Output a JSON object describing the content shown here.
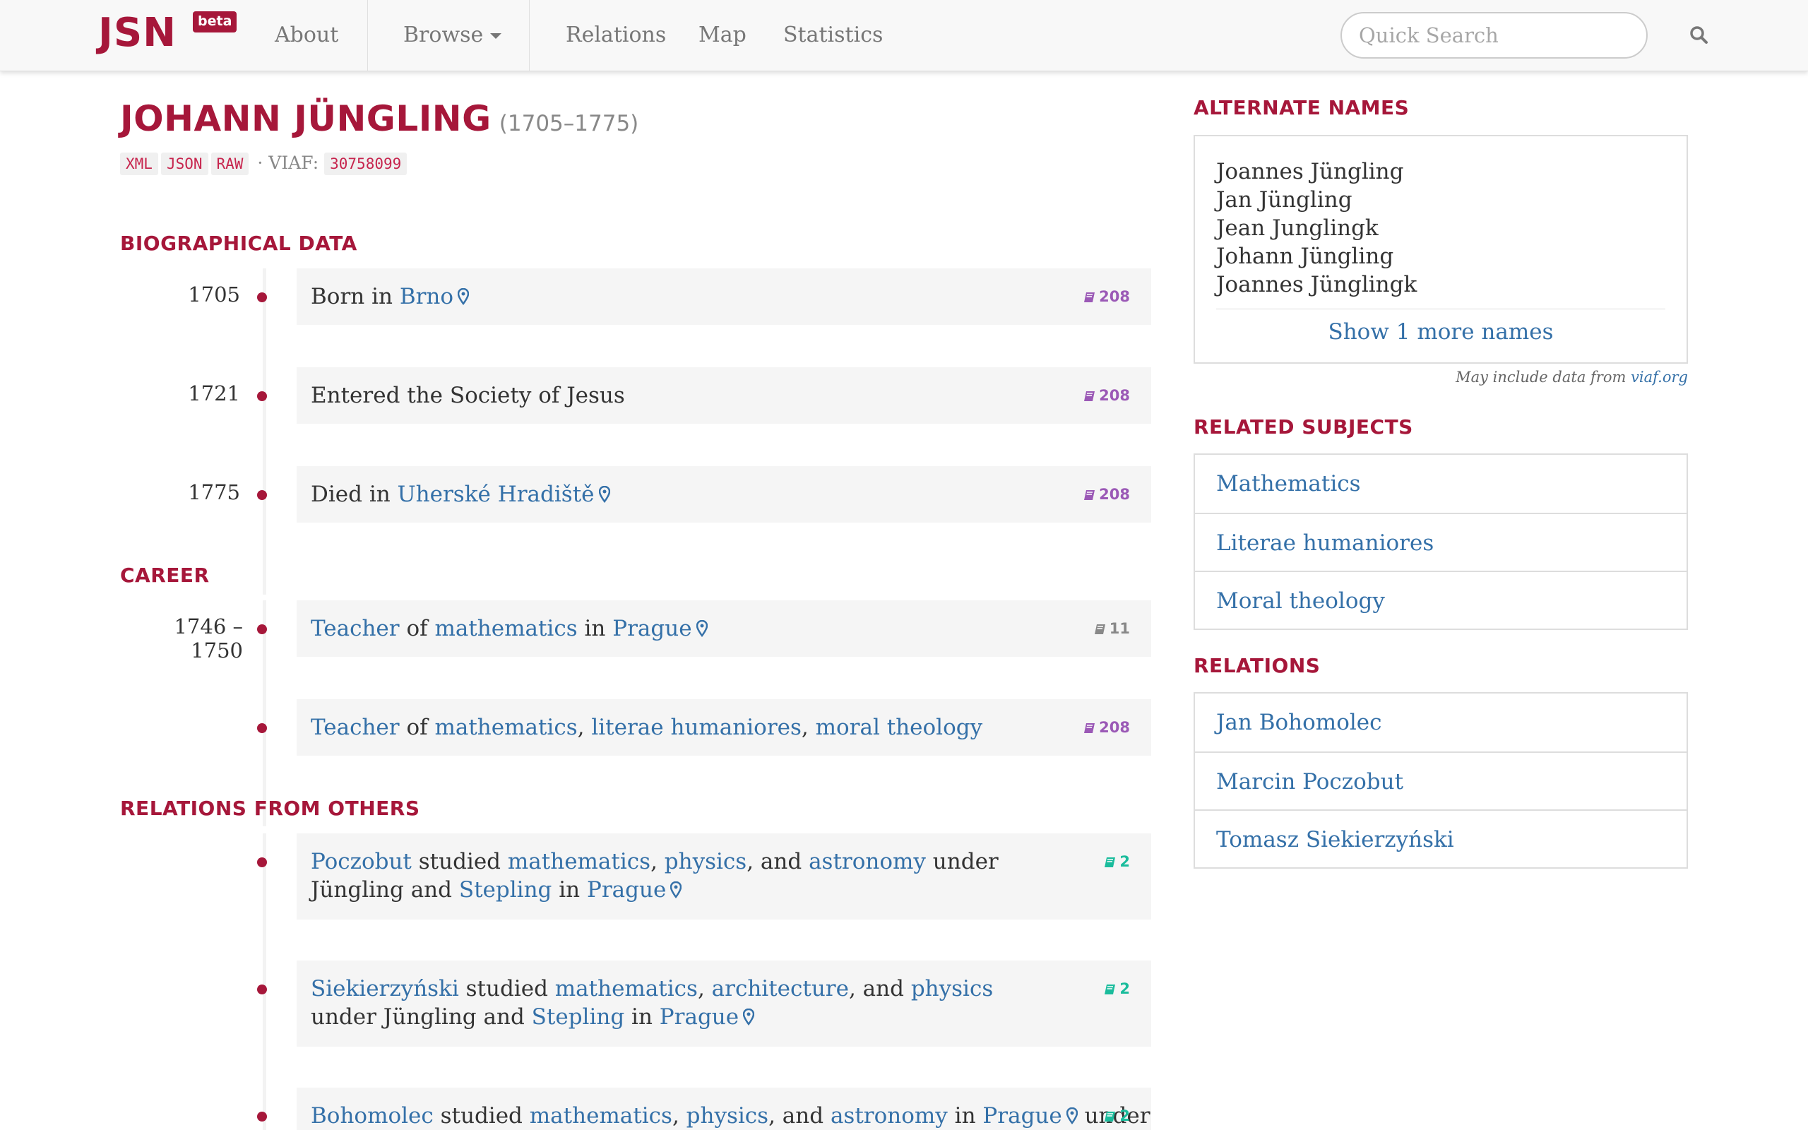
{
  "navbar": {
    "brand": "JSN",
    "beta": "beta",
    "items": [
      "About",
      "Browse",
      "Relations",
      "Map",
      "Statistics"
    ],
    "search_placeholder": "Quick Search"
  },
  "person": {
    "name": "JOHANN JÜNGLING",
    "dates": "(1705–1775)",
    "formats": [
      "XML",
      "JSON",
      "RAW"
    ],
    "viaf_label": "· VIAF:",
    "viaf_id": "30758099"
  },
  "sections": {
    "bio": "BIOGRAPHICAL DATA",
    "career": "CAREER",
    "relations_from_others": "RELATIONS FROM OTHERS"
  },
  "bio": [
    {
      "year": "1705",
      "pre": "Born in ",
      "place": "Brno",
      "ref": "208"
    },
    {
      "year": "1721",
      "text": "Entered the Society of Jesus",
      "ref": "208"
    },
    {
      "year": "1775",
      "pre": "Died in ",
      "place": "Uherské Hradiště",
      "ref": "208"
    }
  ],
  "career": [
    {
      "year": "1746 – 1750",
      "role": "Teacher",
      "of": " of ",
      "subject": "mathematics",
      "in": " in ",
      "place": "Prague",
      "ref": "11"
    },
    {
      "role": "Teacher",
      "of": " of ",
      "subjects": [
        "mathematics",
        "literae humaniores",
        "moral theology"
      ],
      "sep": ", ",
      "ref": "208"
    }
  ],
  "relations_from_others": [
    {
      "who": "Poczobut",
      "verb": " studied ",
      "subjects": [
        "mathematics",
        "physics",
        "astronomy"
      ],
      "tail1": " under Jüngling and",
      "teacher2": "Stepling",
      "in": " in ",
      "place": "Prague",
      "ref": "2"
    },
    {
      "who": "Siekierzyński",
      "verb": " studied ",
      "subjects": [
        "mathematics",
        "architecture",
        "physics"
      ],
      "tail1": " under Jüngling",
      "and": "and ",
      "teacher2": "Stepling",
      "in": " in ",
      "place": "Prague",
      "ref": "2"
    },
    {
      "who": "Bohomolec",
      "verb": " studied ",
      "subjects": [
        "mathematics",
        "physics",
        "astronomy"
      ],
      "in": " in ",
      "place": "Prague",
      "tail1": " under",
      "ref": "2"
    }
  ],
  "words": {
    "comma": ", ",
    "and": ", and "
  },
  "sidebar": {
    "alt_title": "ALTERNATE NAMES",
    "alt_names": [
      "Joannes Jüngling",
      "Jan Jüngling",
      "Jean Junglingk",
      "Johann Jüngling",
      "Joannes Jünglingk"
    ],
    "show_more": "Show 1 more names",
    "viaf_note": "May include data from ",
    "viaf_link": "viaf.org",
    "subjects_title": "RELATED SUBJECTS",
    "subjects": [
      "Mathematics",
      "Literae humaniores",
      "Moral theology"
    ],
    "relations_title": "RELATIONS",
    "relations": [
      "Jan Bohomolec",
      "Marcin Poczobut",
      "Tomasz Siekierzyński"
    ]
  },
  "colors": {
    "accent": "#a6173a",
    "link": "#3470a8",
    "ref_purple": "#9b59b6",
    "ref_teal": "#1abc9c",
    "ref_gray": "#888888"
  },
  "icons": {
    "search": "search-icon",
    "pin": "map-pin-icon",
    "book": "book-icon",
    "caret": "caret-down-icon"
  }
}
